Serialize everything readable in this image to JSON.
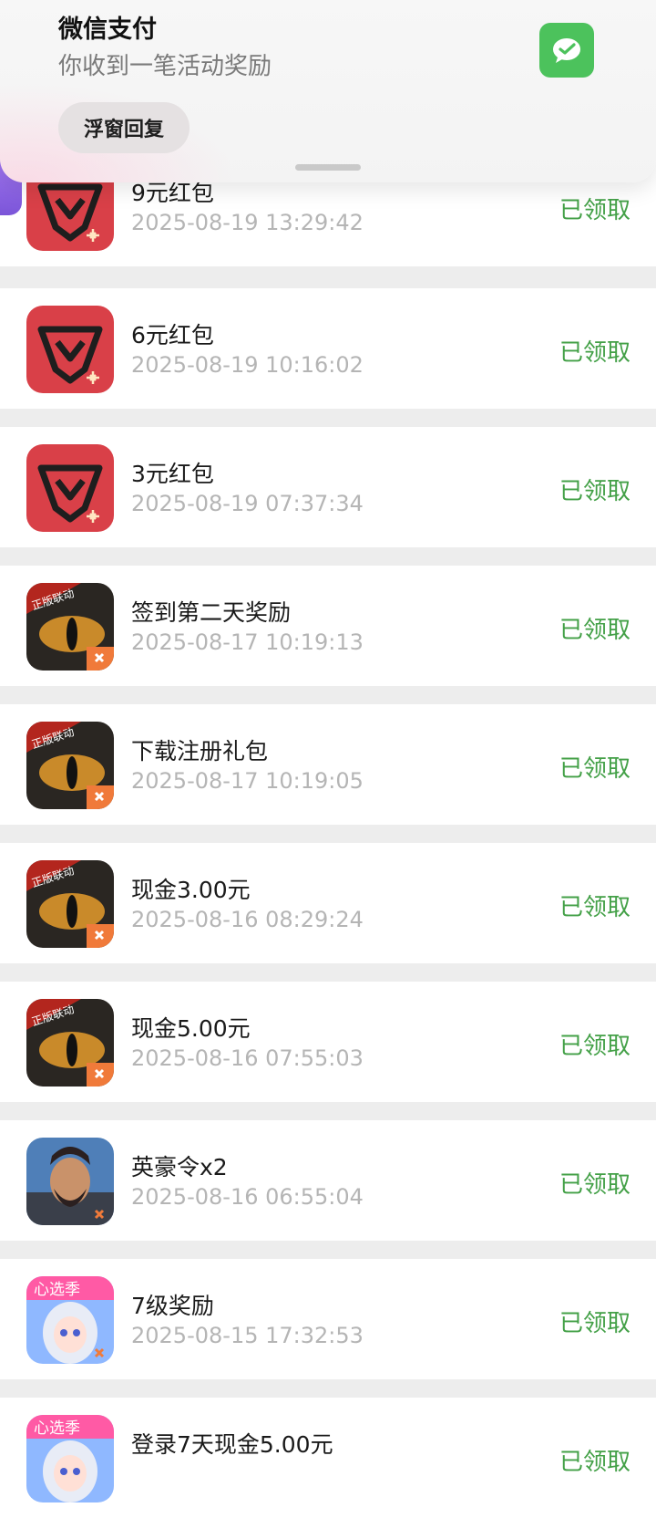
{
  "notification": {
    "app_name": "微信支付",
    "message": "你收到一笔活动奖励",
    "reply_button": "浮窗回复",
    "app_icon": "wechat-pay-icon"
  },
  "records": [
    {
      "title": "9元红包",
      "time": "2025-08-19 13:29:42",
      "status": "已领取",
      "icon": "game-shield-icon"
    },
    {
      "title": "6元红包",
      "time": "2025-08-19 10:16:02",
      "status": "已领取",
      "icon": "game-shield-icon"
    },
    {
      "title": "3元红包",
      "time": "2025-08-19 07:37:34",
      "status": "已领取",
      "icon": "game-shield-icon"
    },
    {
      "title": "签到第二天奖励",
      "time": "2025-08-17 10:19:13",
      "status": "已领取",
      "icon": "dragon-eye-icon"
    },
    {
      "title": "下载注册礼包",
      "time": "2025-08-17 10:19:05",
      "status": "已领取",
      "icon": "dragon-eye-icon"
    },
    {
      "title": "现金3.00元",
      "time": "2025-08-16 08:29:24",
      "status": "已领取",
      "icon": "dragon-eye-icon"
    },
    {
      "title": "现金5.00元",
      "time": "2025-08-16 07:55:03",
      "status": "已领取",
      "icon": "dragon-eye-icon"
    },
    {
      "title": "英豪令x2",
      "time": "2025-08-16 06:55:04",
      "status": "已领取",
      "icon": "warrior-portrait-icon"
    },
    {
      "title": "7级奖励",
      "time": "2025-08-15 17:32:53",
      "status": "已领取",
      "icon": "anime-girl-icon"
    },
    {
      "title": "登录7天现金5.00元",
      "time": "",
      "status": "已领取",
      "icon": "anime-girl-icon"
    }
  ],
  "icon_text": {
    "dragon_badge": "正版联动",
    "anime_badge": "心选季"
  },
  "colors": {
    "status_green": "#43a047",
    "background": "#ededed",
    "shield_red": "#d94048",
    "wechat_green": "#4cc25c"
  }
}
